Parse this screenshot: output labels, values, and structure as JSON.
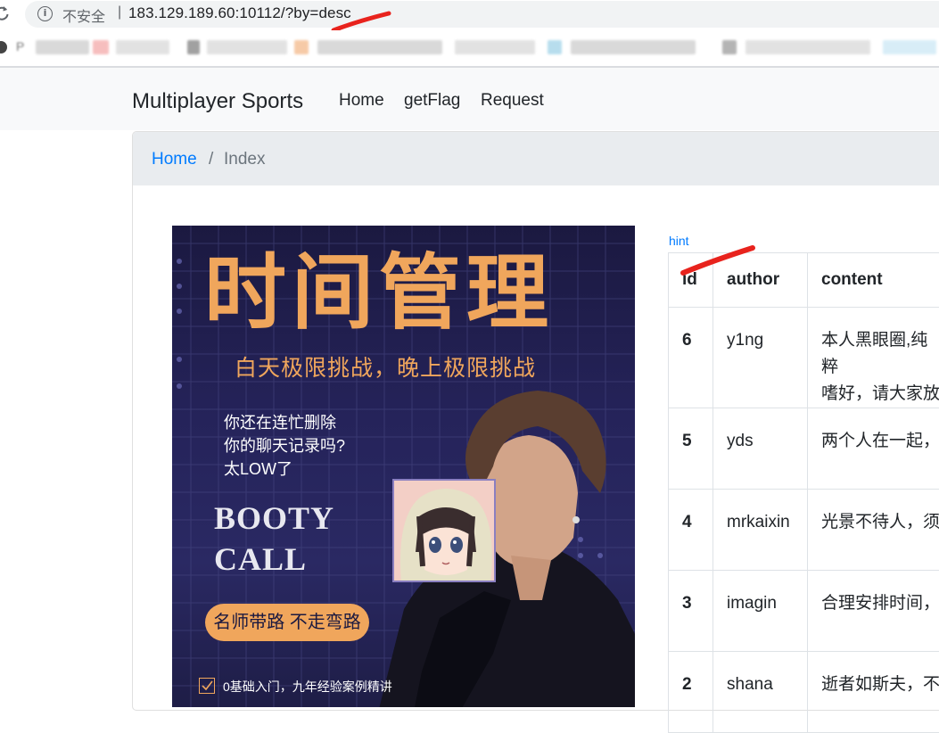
{
  "browser": {
    "security_label": "不安全",
    "security_sep": "|",
    "url": "183.129.189.60:10112/?by=desc",
    "bookmark_first_label": "P"
  },
  "navbar": {
    "brand": "Multiplayer Sports",
    "links": [
      "Home",
      "getFlag",
      "Request"
    ]
  },
  "breadcrumb": {
    "home": "Home",
    "separator": "/",
    "current": "Index"
  },
  "poster": {
    "title": "时间管理",
    "subtitle": "白天极限挑战，晚上极限挑战",
    "question": "你还在连忙删除\n你的聊天记录吗?\n太LOW了",
    "brand": "BOOTY\nCALL",
    "pill": "名师带路 不走弯路",
    "footer": "0基础入门，九年经验案例精讲"
  },
  "table": {
    "hint": "hint",
    "headers": [
      "id",
      "author",
      "content"
    ],
    "rows": [
      {
        "id": "6",
        "author": "y1ng",
        "content": "本人黑眼圈,纯粹\n嗜好，请大家放"
      },
      {
        "id": "5",
        "author": "yds",
        "content": "两个人在一起，"
      },
      {
        "id": "4",
        "author": "mrkaixin",
        "content": "光景不待人，须"
      },
      {
        "id": "3",
        "author": "imagin",
        "content": "合理安排时间，"
      },
      {
        "id": "2",
        "author": "shana",
        "content": "逝者如斯夫，不"
      }
    ]
  },
  "colors": {
    "link": "#007bff",
    "navbar_bg": "#f8f9fa",
    "breadcrumb_bg": "#e9ecef",
    "poster_accent": "#f0a65c",
    "poster_bg": "#25235a",
    "annotation_red": "#e8231d"
  },
  "icons": [
    "reload-icon",
    "info-icon",
    "checkbox-icon"
  ]
}
